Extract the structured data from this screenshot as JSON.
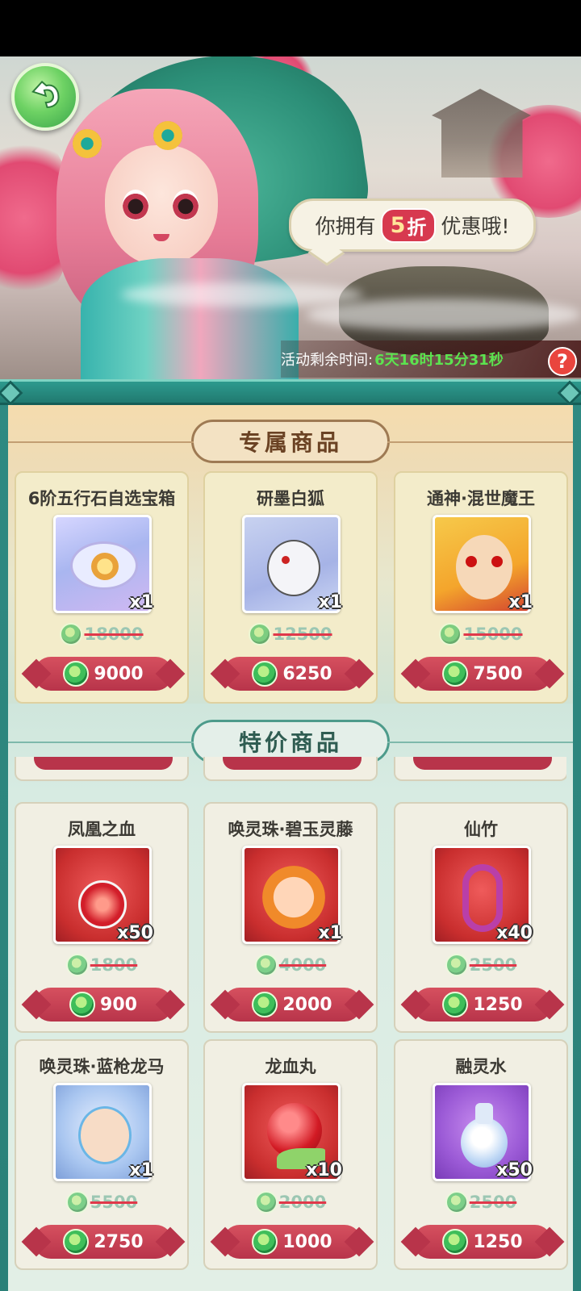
{
  "banner": {
    "bubble_prefix": "你拥有",
    "discount_number": "5",
    "discount_unit": "折",
    "bubble_suffix": "优惠哦!",
    "timer_label": "活动剩余时间:",
    "timer_value": "6天16时15分31秒",
    "help_label": "?"
  },
  "sections": {
    "exclusive_title": "专属商品",
    "special_title": "特价商品"
  },
  "exclusive_items": [
    {
      "name": "6阶五行石自选宝箱",
      "qty": "x1",
      "old_price": "18000",
      "price": "9000",
      "icon": "treasure-chest-icon"
    },
    {
      "name": "研墨白狐",
      "qty": "x1",
      "old_price": "12500",
      "price": "6250",
      "icon": "white-fox-icon"
    },
    {
      "name": "通神·混世魔王",
      "qty": "x1",
      "old_price": "15000",
      "price": "7500",
      "icon": "demon-king-icon"
    }
  ],
  "special_items": [
    {
      "name": "凤凰之血",
      "qty": "x50",
      "old_price": "1800",
      "price": "900",
      "icon": "phoenix-blood-potion-icon"
    },
    {
      "name": "唤灵珠·碧玉灵藤",
      "qty": "x1",
      "old_price": "4000",
      "price": "2000",
      "icon": "spirit-orb-jade-vine-icon"
    },
    {
      "name": "仙竹",
      "qty": "x40",
      "old_price": "2500",
      "price": "1250",
      "icon": "immortal-bamboo-icon"
    },
    {
      "name": "唤灵珠·蓝枪龙马",
      "qty": "x1",
      "old_price": "5500",
      "price": "2750",
      "icon": "spirit-orb-blue-spear-icon"
    },
    {
      "name": "龙血丸",
      "qty": "x10",
      "old_price": "2000",
      "price": "1000",
      "icon": "dragon-blood-pill-icon"
    },
    {
      "name": "融灵水",
      "qty": "x50",
      "old_price": "2500",
      "price": "1250",
      "icon": "spirit-water-vase-icon"
    }
  ],
  "colors": {
    "price_button": "#b8344a",
    "timer_value": "#5ce34f",
    "frame": "#2f8a82",
    "currency": "#3fbe5a"
  }
}
